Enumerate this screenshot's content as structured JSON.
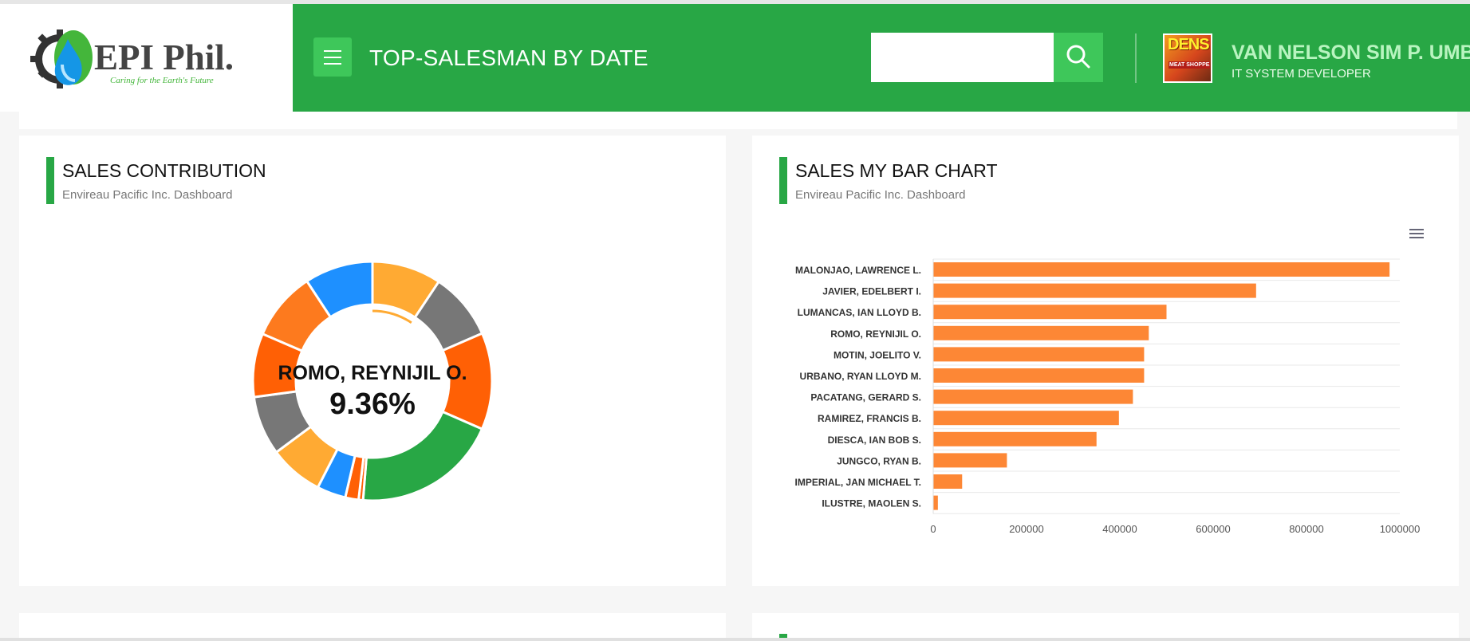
{
  "brand": {
    "name": "EPI Phil.",
    "tagline": "Caring for the Earth's Future"
  },
  "header": {
    "title": "TOP-SALESMAN BY DATE",
    "search_value": "",
    "search_placeholder": ""
  },
  "user": {
    "name": "VAN NELSON SIM P. UMBAY",
    "role": "IT SYSTEM DEVELOPER",
    "avatar_text": "DENS",
    "avatar_subtext": "MEAT SHOPPE"
  },
  "cards": {
    "sales_contribution": {
      "title": "SALES CONTRIBUTION",
      "subtitle": "Envireau Pacific Inc. Dashboard",
      "center_name": "ROMO, REYNIJIL O.",
      "center_value": "9.36%"
    },
    "sales_bar_chart": {
      "title": "SALES MY BAR CHART",
      "subtitle": "Envireau Pacific Inc. Dashboard"
    }
  },
  "colors": {
    "header": "#28a745",
    "button": "#3ec75a",
    "bar": "#fd8735",
    "donut": [
      "#ffaa33",
      "#777777",
      "#ff6005",
      "#28a745",
      "#1e90ff",
      "#ff6005",
      "#ffaa33",
      "#777777",
      "#ff6005",
      "#fd7a1e",
      "#1e90ff"
    ]
  },
  "chart_data": [
    {
      "type": "pie",
      "title": "",
      "slices": [
        {
          "value": 9.36,
          "color": "#ffaa33"
        },
        {
          "value": 9.1,
          "color": "#777777"
        },
        {
          "value": 13.1,
          "color": "#ff6005"
        },
        {
          "value": 19.7,
          "color": "#28a745"
        },
        {
          "value": 0.6,
          "color": "#ff6005"
        },
        {
          "value": 1.8,
          "color": "#ff6005"
        },
        {
          "value": 3.9,
          "color": "#1e90ff"
        },
        {
          "value": 7.3,
          "color": "#ffaa33"
        },
        {
          "value": 8.0,
          "color": "#777777"
        },
        {
          "value": 8.6,
          "color": "#ff6005"
        },
        {
          "value": 9.3,
          "color": "#fd7a1e"
        },
        {
          "value": 9.24,
          "color": "#1e90ff"
        }
      ]
    },
    {
      "type": "bar",
      "orientation": "horizontal",
      "categories": [
        "MALONJAO, LAWRENCE L.",
        "JAVIER, EDELBERT I.",
        "LUMANCAS, IAN LLOYD B.",
        "ROMO, REYNIJIL O.",
        "MOTIN, JOELITO V.",
        "URBANO, RYAN LLOYD M.",
        "PACATANG, GERARD S.",
        "RAMIREZ, FRANCIS B.",
        "DIESCA, IAN BOB S.",
        "JUNGCO, RYAN B.",
        "IMPERIAL, JAN MICHAEL T.",
        "ILUSTRE, MAOLEN S."
      ],
      "values": [
        978000,
        692000,
        500000,
        462000,
        452000,
        452000,
        428000,
        398000,
        350000,
        158000,
        62000,
        10000
      ],
      "x_ticks": [
        "0",
        "200000",
        "400000",
        "600000",
        "800000",
        "1000000"
      ],
      "xlim": [
        0,
        1000000
      ],
      "grid": true
    }
  ]
}
